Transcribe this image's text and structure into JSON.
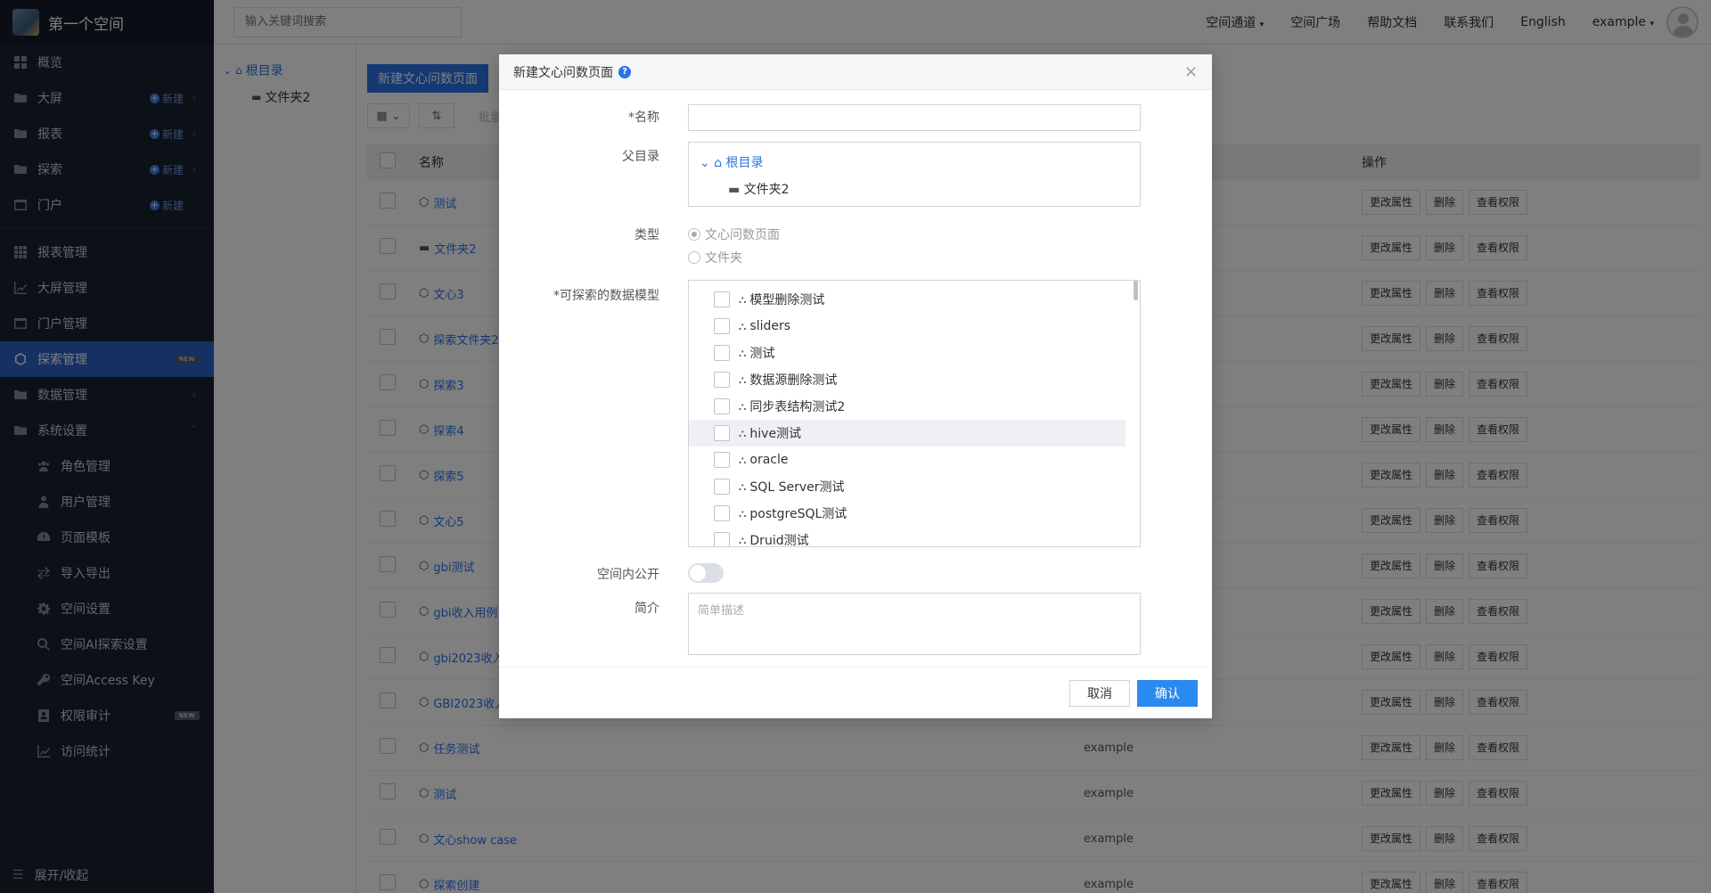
{
  "sidebar": {
    "title": "第一个空间",
    "items": [
      {
        "label": "概览",
        "icon": "dashboard-icon"
      },
      {
        "label": "大屏",
        "icon": "folder-icon",
        "new": "新建"
      },
      {
        "label": "报表",
        "icon": "folder-icon",
        "new": "新建"
      },
      {
        "label": "探索",
        "icon": "folder-icon",
        "new": "新建"
      },
      {
        "label": "门户",
        "icon": "window-icon",
        "new": "新建"
      }
    ],
    "manage": [
      {
        "label": "报表管理"
      },
      {
        "label": "大屏管理"
      },
      {
        "label": "门户管理"
      },
      {
        "label": "探索管理",
        "badge": "NEW"
      },
      {
        "label": "数据管理"
      },
      {
        "label": "系统设置"
      }
    ],
    "settings": [
      {
        "label": "角色管理"
      },
      {
        "label": "用户管理"
      },
      {
        "label": "页面模板"
      },
      {
        "label": "导入导出"
      },
      {
        "label": "空间设置"
      },
      {
        "label": "空间AI探索设置"
      },
      {
        "label": "空间Access Key"
      },
      {
        "label": "权限审计",
        "badge": "NEW"
      },
      {
        "label": "访问统计"
      }
    ],
    "footer": "展开/收起"
  },
  "topbar": {
    "search_placeholder": "输入关键词搜索",
    "links": [
      "空间通道",
      "空间广场",
      "帮助文档",
      "联系我们",
      "English",
      "example"
    ]
  },
  "tree": {
    "root": "根目录",
    "child": "文件夹2"
  },
  "main": {
    "new_button": "新建文心问数页面",
    "batch": "批量",
    "headers": {
      "name": "名称",
      "ops": "操作"
    },
    "ops": [
      "更改属性",
      "删除",
      "查看权限"
    ],
    "rows": [
      {
        "name": "测试",
        "owner": ""
      },
      {
        "name": "文件夹2",
        "owner": "",
        "folder": true
      },
      {
        "name": "文心3",
        "owner": ""
      },
      {
        "name": "探索文件夹2",
        "owner": ""
      },
      {
        "name": "探索3",
        "owner": ""
      },
      {
        "name": "探索4",
        "owner": ""
      },
      {
        "name": "探索5",
        "owner": ""
      },
      {
        "name": "文心5",
        "owner": ""
      },
      {
        "name": "gbi测试",
        "owner": ""
      },
      {
        "name": "gbi收入用例",
        "owner": ""
      },
      {
        "name": "gbi2023收入",
        "owner": ""
      },
      {
        "name": "GBI2023收入",
        "owner": ""
      },
      {
        "name": "任务测试",
        "owner": "example"
      },
      {
        "name": "测试",
        "owner": "example"
      },
      {
        "name": "文心show case",
        "owner": "example"
      },
      {
        "name": "探索创建",
        "owner": "example"
      }
    ]
  },
  "modal": {
    "title": "新建文心问数页面",
    "name_label": "*名称",
    "parent_label": "父目录",
    "parent_root": "根目录",
    "parent_child": "文件夹2",
    "type_label": "类型",
    "type_options": [
      "文心问数页面",
      "文件夹"
    ],
    "models_label": "*可探索的数据模型",
    "models": [
      "模型删除测试",
      "sliders",
      "测试",
      "数据源删除测试",
      "同步表结构测试2",
      "hive测试",
      "oracle",
      "SQL Server测试",
      "postgreSQL测试",
      "Druid测试"
    ],
    "public_label": "空间内公开",
    "intro_label": "简介",
    "intro_placeholder": "简单描述",
    "cancel": "取消",
    "confirm": "确认"
  }
}
